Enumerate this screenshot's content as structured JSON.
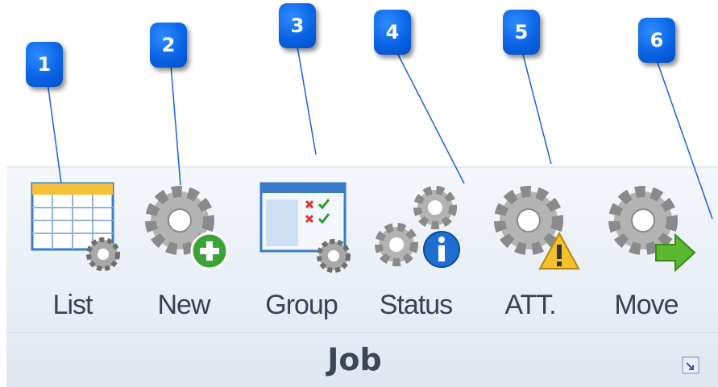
{
  "ribbon_group": {
    "title": "Job",
    "buttons": [
      {
        "label": "List",
        "icon": "list-table-gear-icon"
      },
      {
        "label": "New",
        "icon": "gear-plus-icon"
      },
      {
        "label": "Group",
        "icon": "group-checklist-gear-icon"
      },
      {
        "label": "Status",
        "icon": "gears-info-icon"
      },
      {
        "label": "ATT.",
        "icon": "gear-warning-icon"
      },
      {
        "label": "Move",
        "icon": "gear-arrow-icon"
      }
    ],
    "launcher_icon": "dialog-launcher-icon"
  },
  "callouts": [
    "1",
    "2",
    "3",
    "4",
    "5",
    "6"
  ],
  "colors": {
    "callout_blue": "#0a64e6",
    "gear_grey": "#9a9a9a",
    "plus_green": "#3aa435",
    "info_blue": "#1f6fd1",
    "warning_yellow": "#f2c12e",
    "arrow_green": "#5cb82e"
  }
}
